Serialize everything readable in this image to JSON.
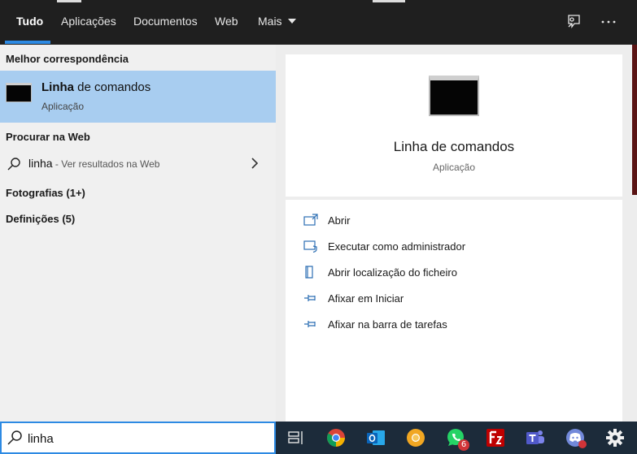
{
  "tabs": [
    {
      "label": "Tudo",
      "active": true
    },
    {
      "label": "Aplicações",
      "active": false
    },
    {
      "label": "Documentos",
      "active": false
    },
    {
      "label": "Web",
      "active": false
    },
    {
      "label": "Mais",
      "active": false
    }
  ],
  "header_icons": [
    "feedback-icon",
    "more-options-icon"
  ],
  "sections": {
    "best_match": "Melhor correspondência",
    "web": "Procurar na Web",
    "photos": "Fotografias (1+)",
    "settings": "Definições (5)"
  },
  "best_result": {
    "title_bold": "Linha",
    "title_rest": " de comandos",
    "subtitle": "Aplicação"
  },
  "web_result": {
    "query": "linha",
    "hint": " - Ver resultados na Web"
  },
  "detail": {
    "title": "Linha de comandos",
    "subtitle": "Aplicação",
    "actions": [
      {
        "label": "Abrir",
        "icon": "open-icon"
      },
      {
        "label": "Executar como administrador",
        "icon": "shield-icon"
      },
      {
        "label": "Abrir localização do ficheiro",
        "icon": "file-location-icon"
      },
      {
        "label": "Afixar em Iniciar",
        "icon": "pin-icon"
      },
      {
        "label": "Afixar na barra de tarefas",
        "icon": "pin-icon"
      }
    ]
  },
  "search": {
    "value": "linha"
  },
  "taskbar": {
    "apps": [
      "task-view-icon",
      "chrome-icon",
      "outlook-icon",
      "chrome-canary-icon",
      "whatsapp-icon",
      "filezilla-icon",
      "teams-icon",
      "discord-icon",
      "settings-gear-icon"
    ],
    "whatsapp_badge": "6"
  },
  "colors": {
    "accent": "#2d8ae3",
    "selected_row": "#a8cdf0",
    "topbar": "#1f1f1f",
    "taskbar": "#1c2b3a"
  }
}
